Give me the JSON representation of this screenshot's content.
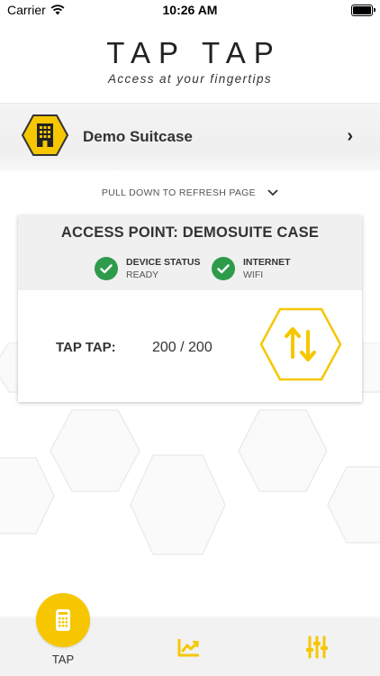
{
  "status_bar": {
    "carrier": "Carrier",
    "time": "10:26 AM"
  },
  "brand": {
    "title": "TAP TAP",
    "tagline": "Access at your fingertips"
  },
  "site": {
    "name": "Demo Suitcase",
    "icon": "building-icon"
  },
  "refresh_hint": "PULL DOWN TO REFRESH PAGE",
  "access_point": {
    "title": "ACCESS POINT: DEMOSUITE CASE",
    "statuses": [
      {
        "label": "DEVICE STATUS",
        "value": "READY",
        "icon": "check-circle-icon"
      },
      {
        "label": "INTERNET",
        "value": "WIFI",
        "icon": "check-circle-icon"
      }
    ],
    "tap_label": "TAP TAP:",
    "tap_count": "200 / 200"
  },
  "tab_bar": {
    "items": [
      {
        "label": "TAP",
        "icon": "keypad-icon",
        "active": true
      },
      {
        "label": "",
        "icon": "chart-icon",
        "active": false
      },
      {
        "label": "",
        "icon": "sliders-icon",
        "active": false
      }
    ]
  },
  "colors": {
    "accent": "#F6C700",
    "success": "#2E9B4B",
    "text": "#333333"
  }
}
